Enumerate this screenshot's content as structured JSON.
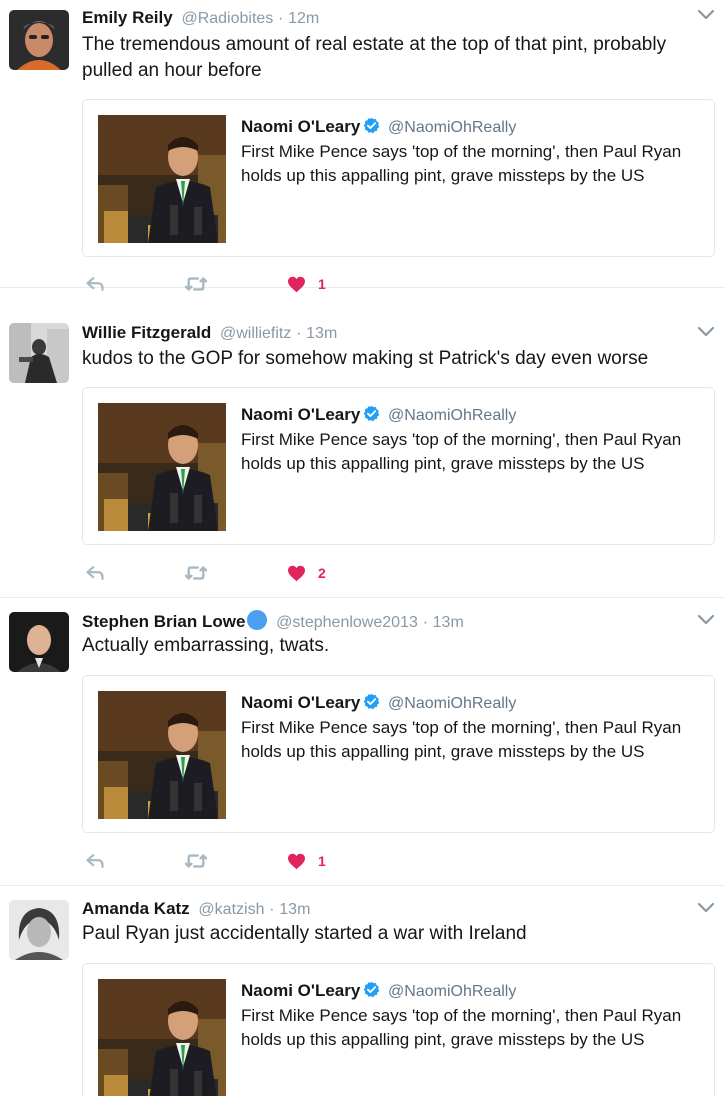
{
  "colors": {
    "like": "#e0245e",
    "verified": "#1da1f2",
    "muted": "#8899a6"
  },
  "quoted_tweet": {
    "name": "Naomi O'Leary",
    "handle": "@NaomiOhReally",
    "text": "First Mike Pence says 'top of the morning', then Paul Ryan holds up this appalling pint, grave missteps by the US",
    "verified": true
  },
  "tweets": [
    {
      "name": "Emily Reily",
      "handle": "@Radiobites",
      "sep": "·",
      "time": "12m",
      "text": "The tremendous amount of real estate at the top of that pint, probably pulled an hour before",
      "likes": "1"
    },
    {
      "name": "Willie Fitzgerald",
      "handle": "@williefitz",
      "sep": "·",
      "time": "13m",
      "text": "kudos to the GOP for somehow making st Patrick's day even worse",
      "likes": "2"
    },
    {
      "name": "Stephen Brian Lowe",
      "handle": "@stephenlowe2013",
      "sep": "·",
      "time": "13m",
      "text": "Actually embarrassing, twats.",
      "likes": "1"
    },
    {
      "name": "Amanda Katz",
      "handle": "@katzish",
      "sep": "·",
      "time": "13m",
      "text": "Paul Ryan just accidentally started a war with Ireland",
      "likes": ""
    }
  ]
}
